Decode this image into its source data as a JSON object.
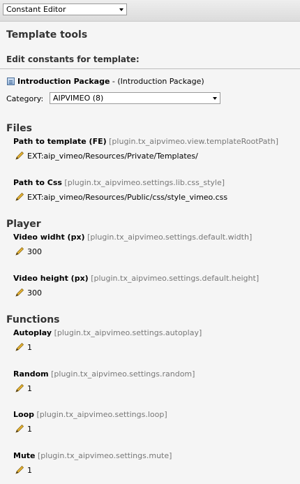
{
  "header": {
    "module_menu": "Constant Editor"
  },
  "tools_title": "Template tools",
  "edit_heading": "Edit constants for template:",
  "template": {
    "name": "Introduction Package",
    "suffix": "- (Introduction Package)"
  },
  "category": {
    "label": "Category:",
    "value": "AIPVIMEO (8)"
  },
  "sections": {
    "files": "Files",
    "player": "Player",
    "functions": "Functions"
  },
  "settings": {
    "template_path": {
      "name": "Path to template (FE)",
      "key": "[plugin.tx_aipvimeo.view.templateRootPath]",
      "value": "EXT:aip_vimeo/Resources/Private/Templates/"
    },
    "css_path": {
      "name": "Path to Css",
      "key": "[plugin.tx_aipvimeo.settings.lib.css_style]",
      "value": "EXT:aip_vimeo/Resources/Public/css/style_vimeo.css"
    },
    "video_width": {
      "name": "Video widht (px)",
      "key": "[plugin.tx_aipvimeo.settings.default.width]",
      "value": "300"
    },
    "video_height": {
      "name": "Video height (px)",
      "key": "[plugin.tx_aipvimeo.settings.default.height]",
      "value": "300"
    },
    "autoplay": {
      "name": "Autoplay",
      "key": "[plugin.tx_aipvimeo.settings.autoplay]",
      "value": "1"
    },
    "random": {
      "name": "Random",
      "key": "[plugin.tx_aipvimeo.settings.random]",
      "value": "1"
    },
    "loop": {
      "name": "Loop",
      "key": "[plugin.tx_aipvimeo.settings.loop]",
      "value": "1"
    },
    "mute": {
      "name": "Mute",
      "key": "[plugin.tx_aipvimeo.settings.mute]",
      "value": "1"
    }
  },
  "icons": {
    "edit": "pencil-icon",
    "template": "template-page-icon",
    "dropdown": "chevron-down-icon"
  },
  "colors": {
    "background": "#f5f5f5",
    "key_text": "#777777",
    "heading": "#333333",
    "pencil": "#e9b533"
  }
}
